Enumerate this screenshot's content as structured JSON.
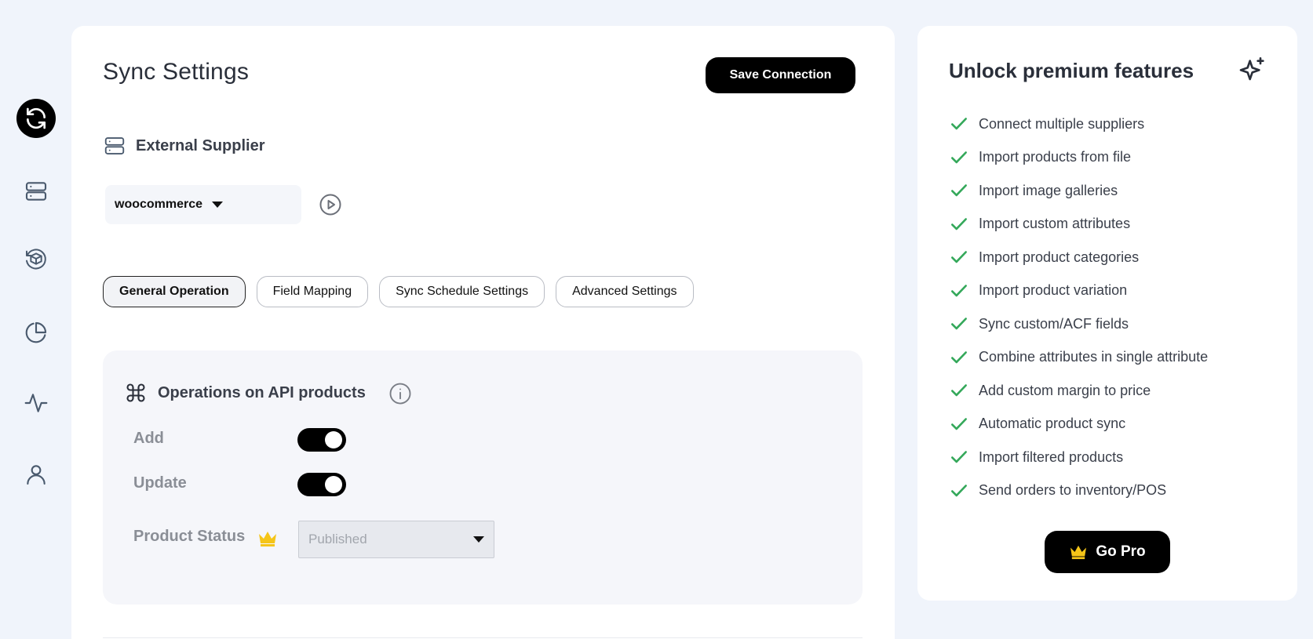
{
  "sidebar": {
    "items": [
      {
        "icon": "sync-icon",
        "active": true
      },
      {
        "icon": "server-icon",
        "active": false
      },
      {
        "icon": "box-refresh-icon",
        "active": false
      },
      {
        "icon": "pie-chart-icon",
        "active": false
      },
      {
        "icon": "activity-icon",
        "active": false
      },
      {
        "icon": "user-icon",
        "active": false
      }
    ]
  },
  "main": {
    "title": "Sync Settings",
    "save_label": "Save Connection",
    "supplier_heading": "External Supplier",
    "supplier_value": "woocommerce",
    "tabs": [
      {
        "label": "General Operation",
        "active": true
      },
      {
        "label": "Field Mapping",
        "active": false
      },
      {
        "label": "Sync Schedule Settings",
        "active": false
      },
      {
        "label": "Advanced Settings",
        "active": false
      }
    ],
    "operations": {
      "heading": "Operations on API products",
      "add_label": "Add",
      "add_enabled": true,
      "update_label": "Update",
      "update_enabled": true,
      "status_label": "Product Status",
      "status_value": "Published"
    }
  },
  "premium": {
    "title": "Unlock premium features",
    "features": [
      "Connect multiple suppliers",
      "Import products from file",
      "Import image galleries",
      "Import custom attributes",
      "Import product categories",
      "Import product variation",
      "Sync custom/ACF fields",
      "Combine attributes in single attribute",
      "Add custom margin to price",
      "Automatic product sync",
      "Import filtered products",
      "Send orders to inventory/POS"
    ],
    "cta_label": "Go Pro"
  },
  "colors": {
    "accent": "#000000",
    "check": "#34a85a",
    "crown": "#f5c518",
    "background": "#f0f4fb"
  }
}
